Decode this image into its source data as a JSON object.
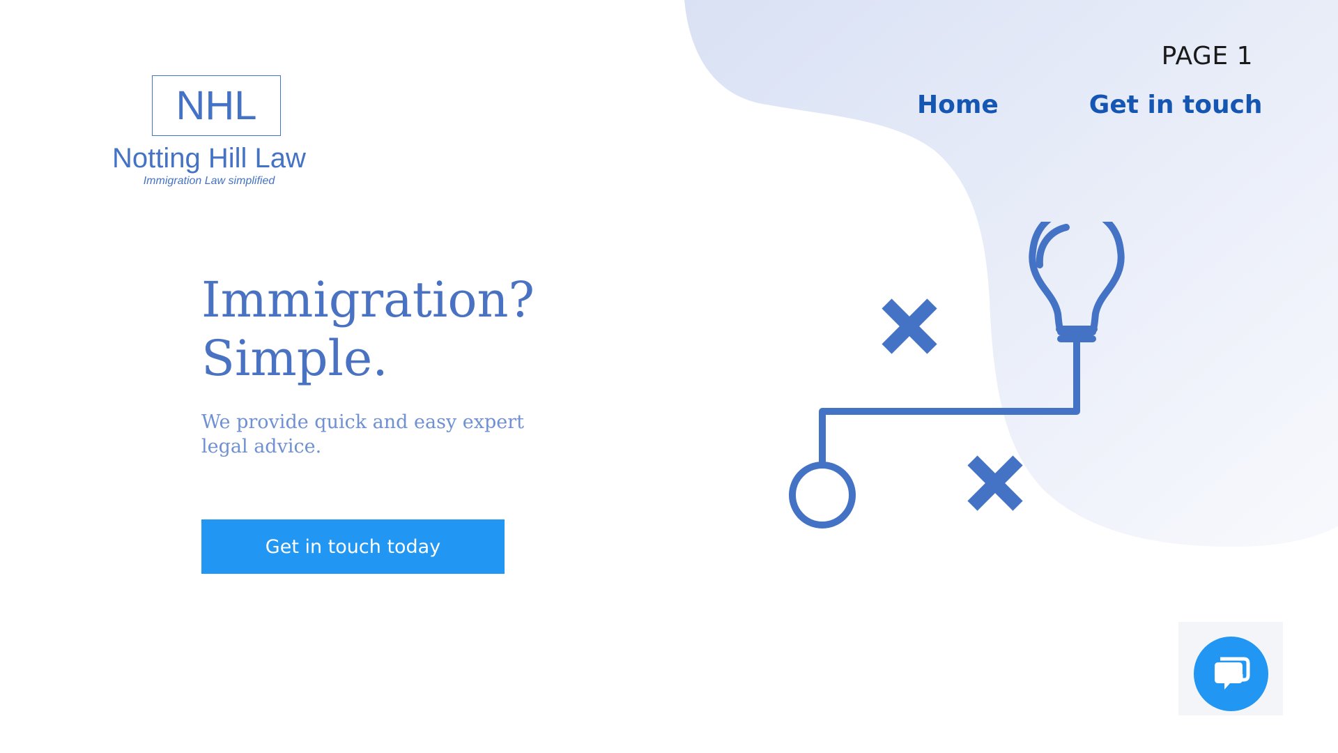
{
  "brand": {
    "abbr": "NHL",
    "name": "Notting Hill Law",
    "tagline": "Immigration Law simplified"
  },
  "header": {
    "page_label": "PAGE 1",
    "nav": [
      {
        "label": "Home"
      },
      {
        "label": "Get in touch"
      }
    ]
  },
  "hero": {
    "title_line1": "Immigration?",
    "title_line2": "Simple.",
    "subtitle": "We provide quick and easy expert legal advice.",
    "cta_label": "Get in touch today"
  },
  "illustration": {
    "icons": [
      "cross-icon",
      "cross-icon",
      "lightbulb-icon",
      "start-node-icon"
    ]
  },
  "chat_widget": {
    "icon": "chat-bubble-icon"
  },
  "colors": {
    "brand_blue": "#4472c4",
    "nav_blue": "#1656b3",
    "cta_blue": "#2196f3",
    "blob_tint": "#dfe6f6",
    "subtitle_blue": "#6f90d2"
  }
}
